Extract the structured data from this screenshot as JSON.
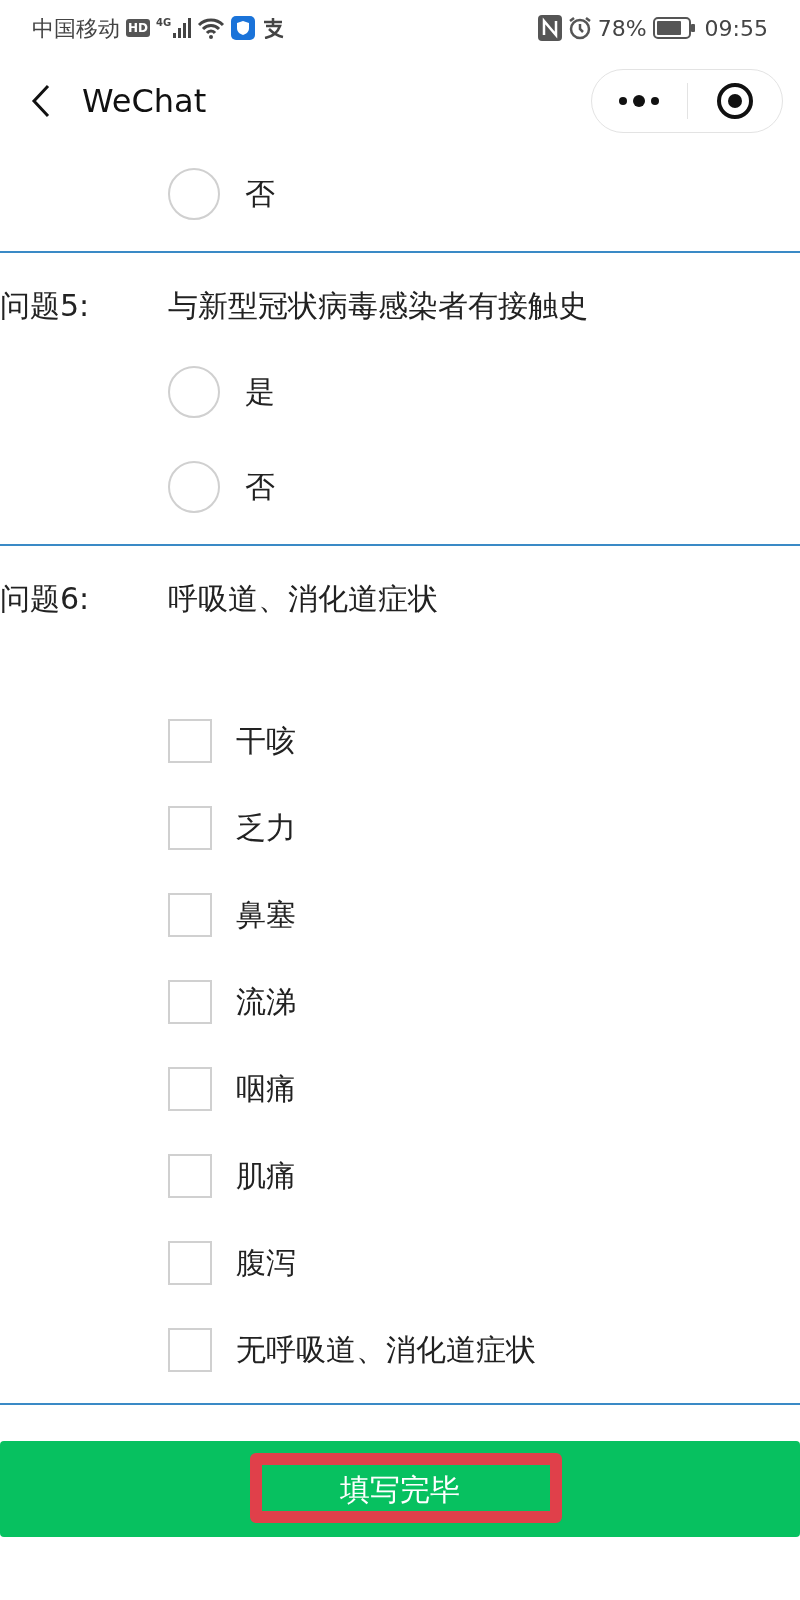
{
  "status_bar": {
    "carrier": "中国移动",
    "hd": "HD",
    "network": "4G",
    "battery": "78%",
    "time": "09:55"
  },
  "nav": {
    "title": "WeChat"
  },
  "questions": [
    {
      "kind": "radio",
      "options": [
        {
          "label": "否",
          "selected": false
        }
      ]
    },
    {
      "kind": "radio",
      "number": "问题5:",
      "text": "与新型冠状病毒感染者有接触史",
      "options": [
        {
          "label": "是",
          "selected": false
        },
        {
          "label": "否",
          "selected": false
        }
      ]
    },
    {
      "kind": "checkbox",
      "number": "问题6:",
      "text": "呼吸道、消化道症状",
      "options": [
        {
          "label": "干咳",
          "checked": false
        },
        {
          "label": "乏力",
          "checked": false
        },
        {
          "label": "鼻塞",
          "checked": false
        },
        {
          "label": "流涕",
          "checked": false
        },
        {
          "label": "咽痛",
          "checked": false
        },
        {
          "label": "肌痛",
          "checked": false
        },
        {
          "label": "腹泻",
          "checked": false
        },
        {
          "label": "无呼吸道、消化道症状",
          "checked": false
        }
      ]
    }
  ],
  "submit": {
    "label": "填写完毕",
    "highlighted": true
  }
}
